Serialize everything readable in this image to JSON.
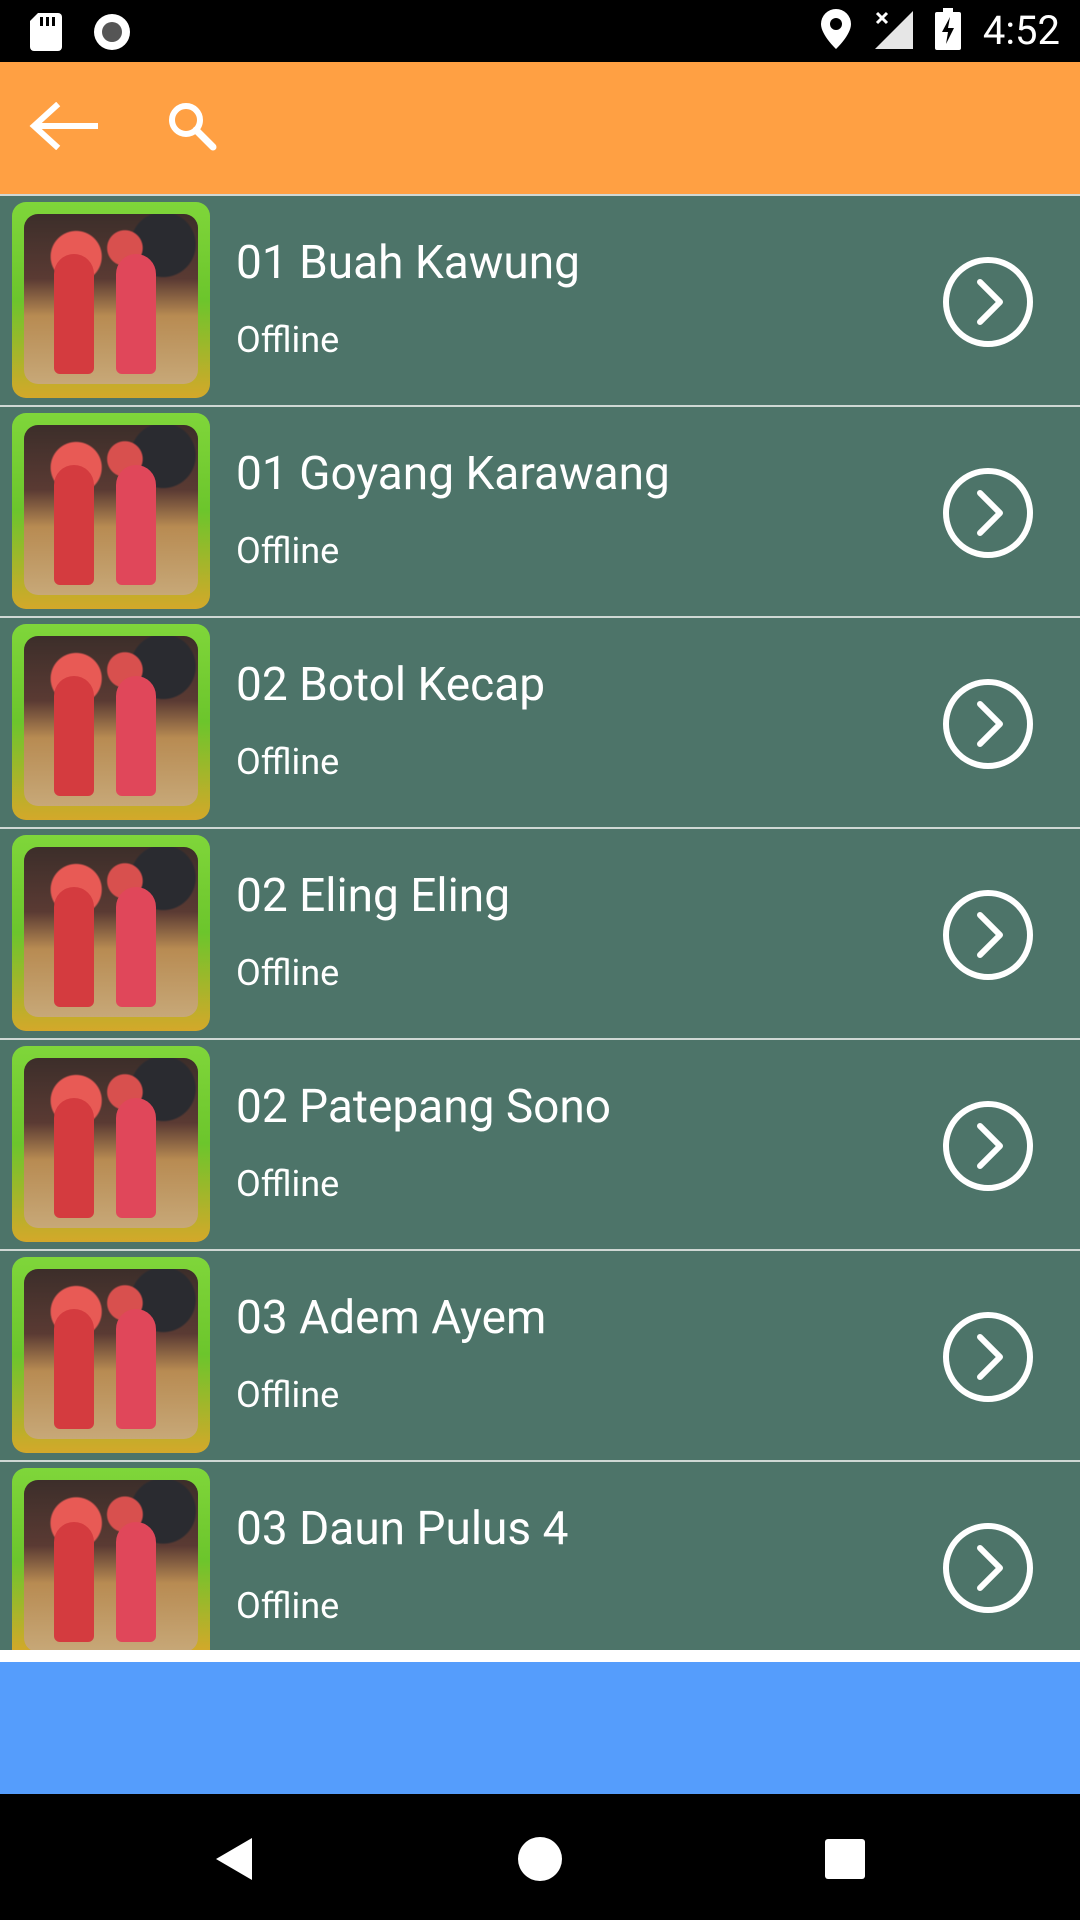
{
  "status_bar": {
    "time": "4:52",
    "icons": [
      "sd-card-icon",
      "record-icon",
      "location-icon",
      "signal-off-icon",
      "battery-charging-icon"
    ]
  },
  "toolbar": {
    "back_icon": "arrow-left-icon",
    "search_icon": "search-icon",
    "background_color": "#ffa043"
  },
  "list": {
    "row_color": "#4d7469",
    "items": [
      {
        "title": "01 Buah Kawung",
        "subtitle": "Offline"
      },
      {
        "title": "01 Goyang Karawang",
        "subtitle": "Offline"
      },
      {
        "title": "02 Botol Kecap",
        "subtitle": "Offline"
      },
      {
        "title": "02 Eling Eling",
        "subtitle": "Offline"
      },
      {
        "title": "02 Patepang Sono",
        "subtitle": "Offline"
      },
      {
        "title": "03 Adem Ayem",
        "subtitle": "Offline"
      },
      {
        "title": "03 Daun Pulus 4",
        "subtitle": "Offline"
      }
    ]
  },
  "banner": {
    "color": "#559dfc"
  },
  "nav_bar": {
    "icons": [
      "back-triangle-icon",
      "home-circle-icon",
      "recents-square-icon"
    ]
  }
}
